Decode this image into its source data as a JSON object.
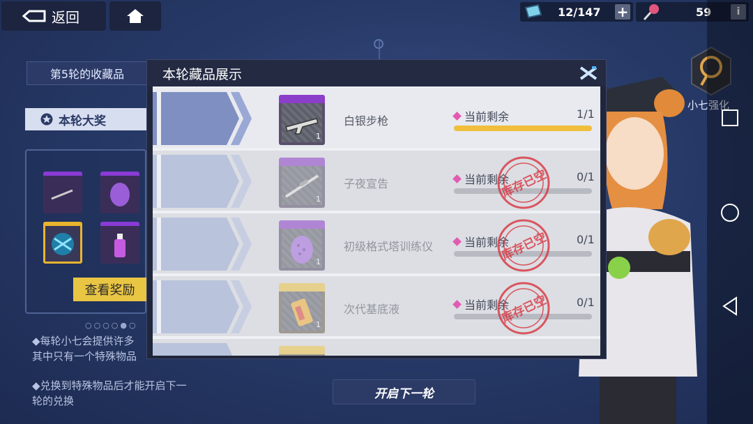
{
  "topbar": {
    "back_label": "返回",
    "ticket_count": "12/147",
    "candy_count": "59"
  },
  "left": {
    "round_title": "第5轮的收藏品",
    "grand_prize_label": "本轮大奖",
    "view_rewards_label": "查看奖励",
    "dots": "○○○○●○",
    "note1": "◆每轮小七会提供许多\n其中只有一个特殊物品",
    "note2": "◆兑换到特殊物品后才能开启下一\n轮的兑换"
  },
  "next_round_label": "开启下一轮",
  "boost_label": "小七强化",
  "modal": {
    "title": "本轮藏品展示",
    "remain_label": "当前剩余",
    "stamp_text": "库存已空",
    "items": [
      {
        "name": "白银步枪",
        "count": "1",
        "remaining": "1/1",
        "fill": 1.0,
        "rarity": "purple",
        "icon": "rifle-icon",
        "sold_out": false
      },
      {
        "name": "子夜宣告",
        "count": "1",
        "remaining": "0/1",
        "fill": 0.0,
        "rarity": "purple",
        "icon": "sniper-icon",
        "sold_out": true
      },
      {
        "name": "初级格式塔训练仪",
        "count": "1",
        "remaining": "0/1",
        "fill": 0.0,
        "rarity": "purple",
        "icon": "device-icon",
        "sold_out": true
      },
      {
        "name": "次代基底液",
        "count": "1",
        "remaining": "0/1",
        "fill": 0.0,
        "rarity": "gold",
        "icon": "vial-icon",
        "sold_out": true
      }
    ]
  },
  "colors": {
    "accent_gold": "#f0be3a",
    "purple_rarity": "#8b3ec9",
    "stamp_red": "#d9343f"
  }
}
